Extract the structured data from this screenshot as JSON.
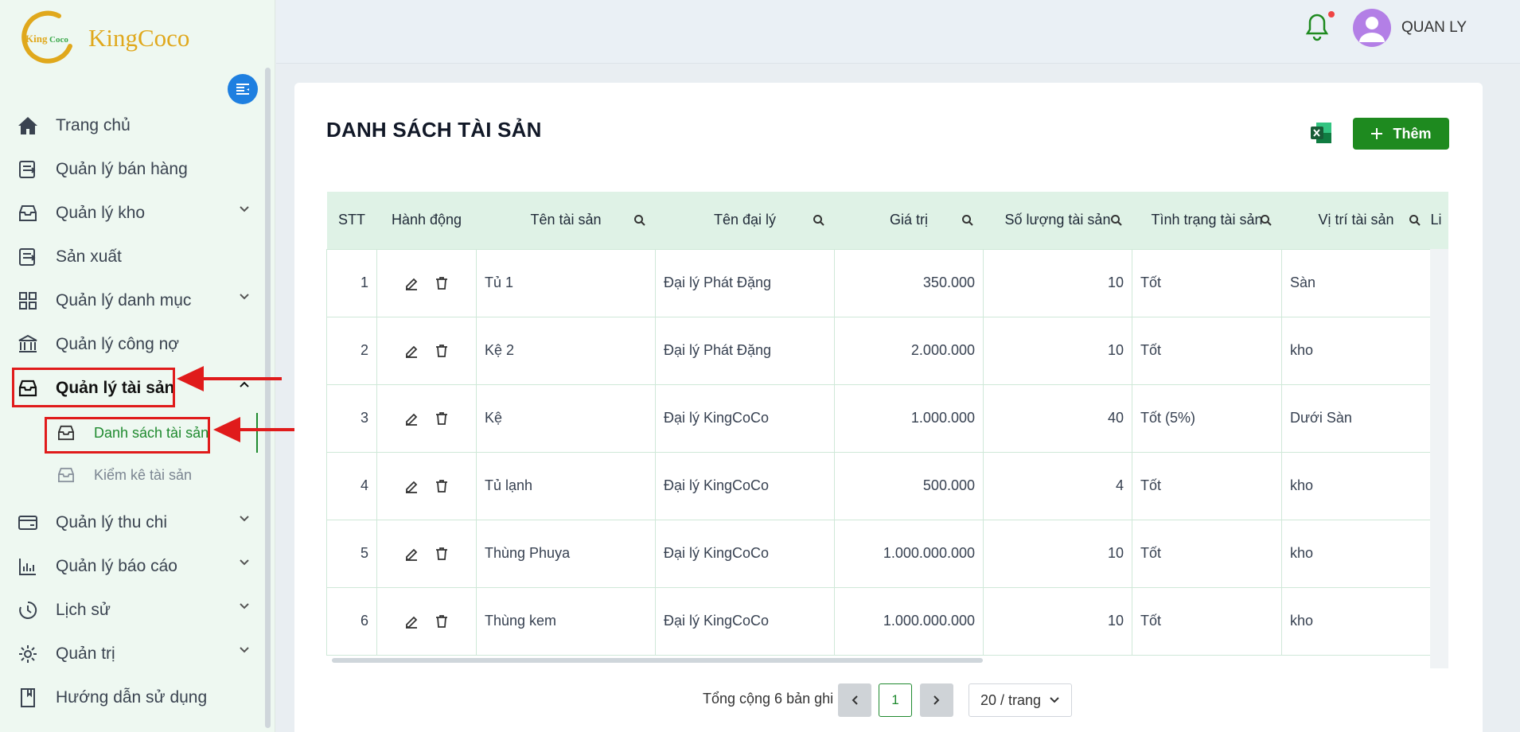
{
  "brand": {
    "name": "KingCoco",
    "logo_text": "KingCoco"
  },
  "sidebar": {
    "items": [
      {
        "label": "Trang chủ",
        "icon": "home-icon",
        "has_chevron": false
      },
      {
        "label": "Quản lý bán hàng",
        "icon": "sales-icon",
        "has_chevron": false
      },
      {
        "label": "Quản lý kho",
        "icon": "warehouse-icon",
        "has_chevron": true
      },
      {
        "label": "Sản xuất",
        "icon": "production-icon",
        "has_chevron": false
      },
      {
        "label": "Quản lý danh mục",
        "icon": "grid-icon",
        "has_chevron": true
      },
      {
        "label": "Quản lý công nợ",
        "icon": "bank-icon",
        "has_chevron": false
      },
      {
        "label": "Quản lý tài sản",
        "icon": "inbox-icon",
        "has_chevron": true,
        "expanded": true
      },
      {
        "label": "Quản lý thu chi",
        "icon": "wallet-icon",
        "has_chevron": true
      },
      {
        "label": "Quản lý báo cáo",
        "icon": "chart-icon",
        "has_chevron": true
      },
      {
        "label": "Lịch sử",
        "icon": "history-icon",
        "has_chevron": true
      },
      {
        "label": "Quản trị",
        "icon": "gear-icon",
        "has_chevron": true
      },
      {
        "label": "Hướng dẫn sử dụng",
        "icon": "book-icon",
        "has_chevron": false
      }
    ],
    "sub_items": [
      {
        "label": "Danh sách tài sản",
        "active": true
      },
      {
        "label": "Kiểm kê tài sản",
        "active": false
      }
    ]
  },
  "header": {
    "username": "QUAN LY"
  },
  "page": {
    "title": "DANH SÁCH TÀI SẢN",
    "add_label": "Thêm"
  },
  "table": {
    "columns": [
      "STT",
      "Hành động",
      "Tên tài sản",
      "Tên đại lý",
      "Giá trị",
      "Số lượng tài sản",
      "Tình trạng tài sản",
      "Vị trí tài sản",
      "Li"
    ],
    "rows": [
      {
        "stt": "1",
        "name": "Tủ 1",
        "agent": "Đại lý Phát Đặng",
        "value": "350.000",
        "qty": "10",
        "status": "Tốt",
        "location": "Sàn"
      },
      {
        "stt": "2",
        "name": "Kệ 2",
        "agent": "Đại lý Phát Đặng",
        "value": "2.000.000",
        "qty": "10",
        "status": "Tốt",
        "location": "kho"
      },
      {
        "stt": "3",
        "name": "Kệ",
        "agent": "Đại lý KingCoCo",
        "value": "1.000.000",
        "qty": "40",
        "status": "Tốt (5%)",
        "location": "Dưới Sàn"
      },
      {
        "stt": "4",
        "name": "Tủ lạnh",
        "agent": "Đại lý KingCoCo",
        "value": "500.000",
        "qty": "4",
        "status": "Tốt",
        "location": "kho"
      },
      {
        "stt": "5",
        "name": "Thùng Phuya",
        "agent": "Đại lý KingCoCo",
        "value": "1.000.000.000",
        "qty": "10",
        "status": "Tốt",
        "location": "kho"
      },
      {
        "stt": "6",
        "name": "Thùng kem",
        "agent": "Đại lý KingCoCo",
        "value": "1.000.000.000",
        "qty": "10",
        "status": "Tốt",
        "location": "kho"
      }
    ]
  },
  "pagination": {
    "total_text": "Tổng cộng 6 bản ghi",
    "current_page": "1",
    "page_size": "20 / trang"
  },
  "colors": {
    "primary_green": "#1e8a1f",
    "highlight_red": "#e01b1b",
    "header_bg": "#dff2e6",
    "logo_gold": "#e0a81c"
  }
}
